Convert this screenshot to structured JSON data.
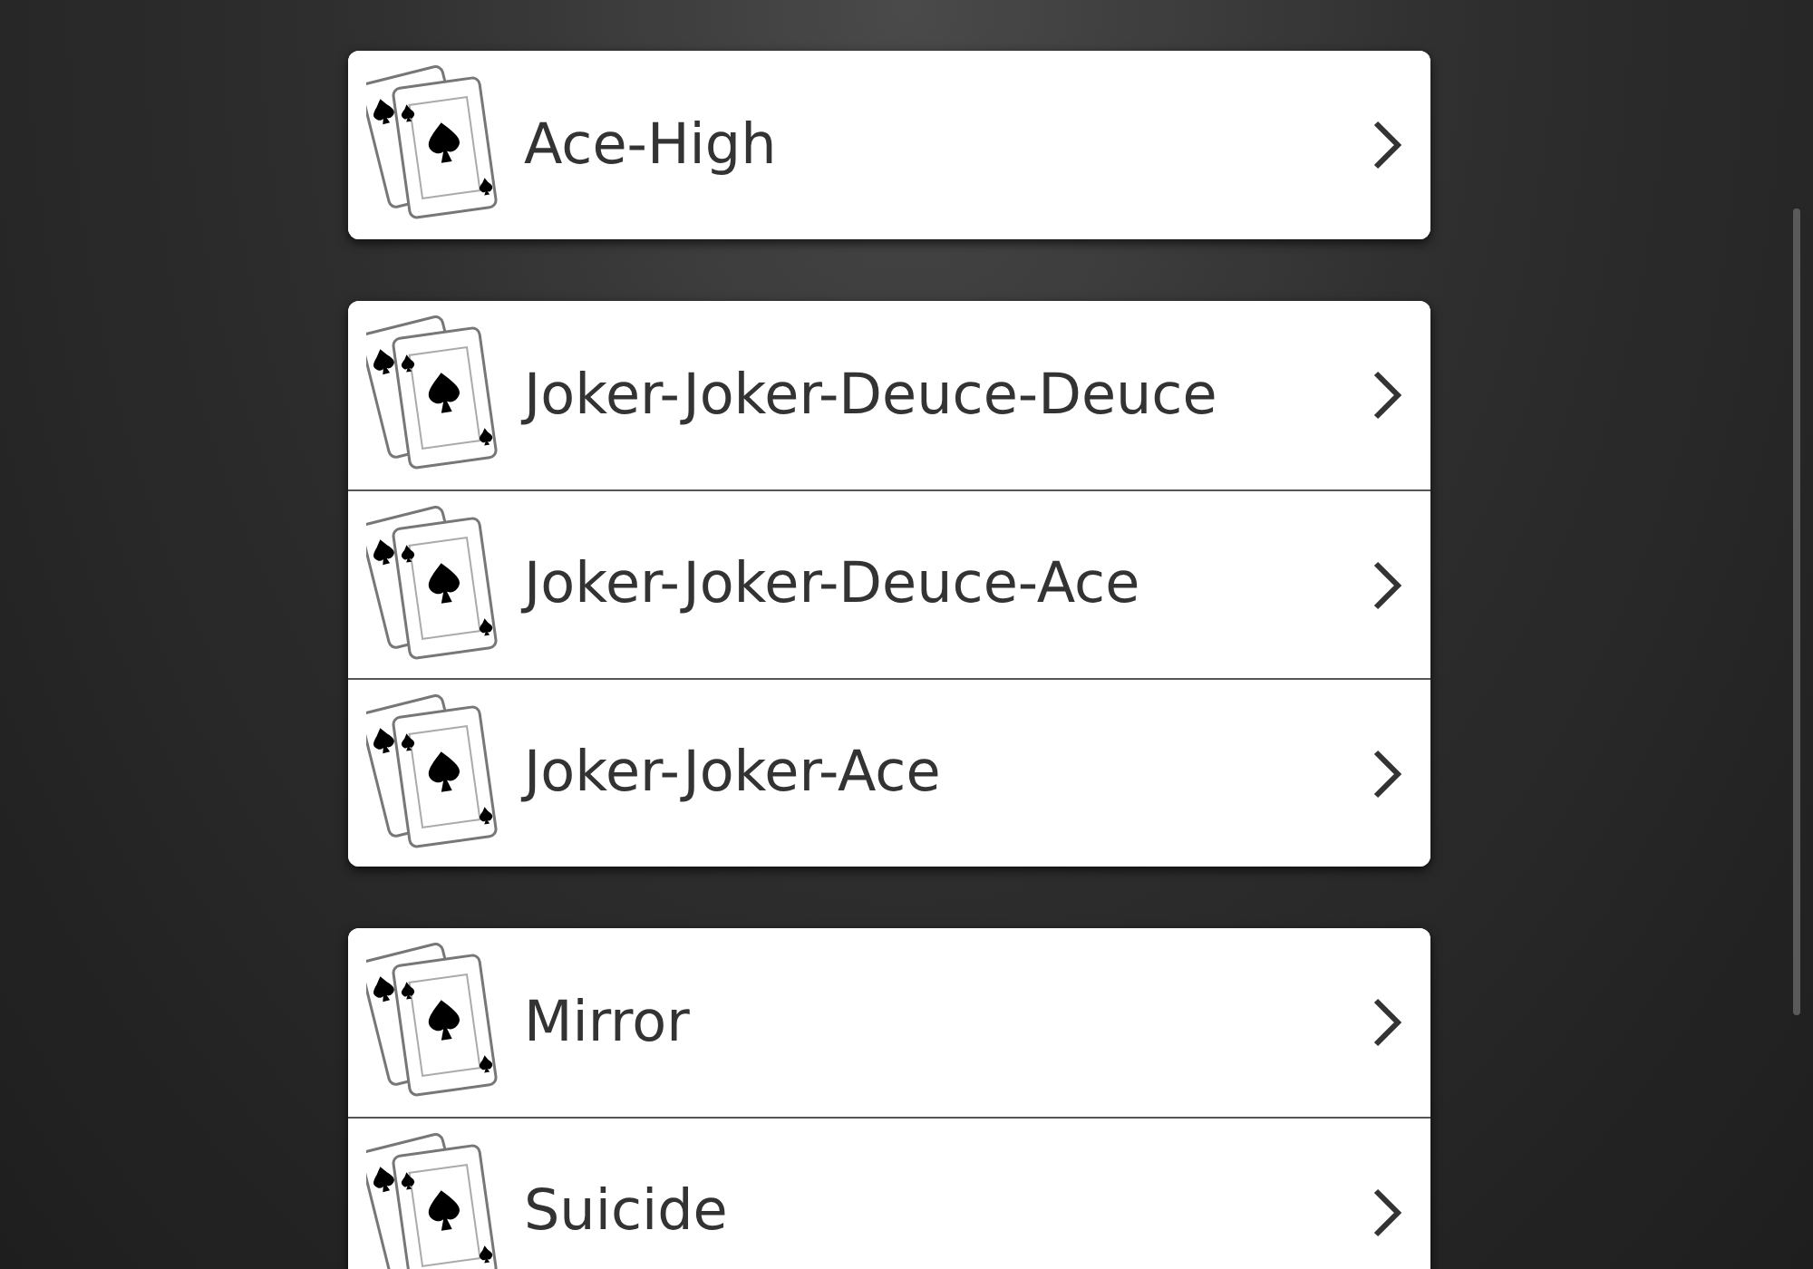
{
  "groups": [
    {
      "items": [
        {
          "label": "Ace-High"
        }
      ]
    },
    {
      "items": [
        {
          "label": "Joker-Joker-Deuce-Deuce"
        },
        {
          "label": "Joker-Joker-Deuce-Ace"
        },
        {
          "label": "Joker-Joker-Ace"
        }
      ]
    },
    {
      "items": [
        {
          "label": "Mirror"
        },
        {
          "label": "Suicide"
        }
      ]
    }
  ]
}
